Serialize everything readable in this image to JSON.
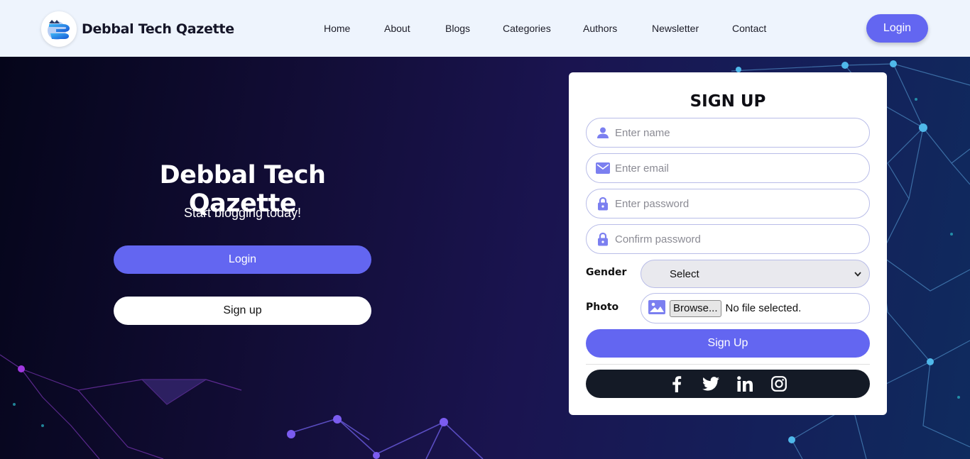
{
  "navbar": {
    "brand": "Debbal Tech Qazette",
    "links": [
      "Home",
      "About",
      "Blogs",
      "Categories",
      "Authors",
      "Newsletter",
      "Contact"
    ],
    "login_label": "Login"
  },
  "hero": {
    "title": "Debbal Tech Qazette",
    "subtitle": "Start blogging today!",
    "login_label": "Login",
    "signup_label": "Sign up"
  },
  "signup_form": {
    "title": "SIGN UP",
    "name_placeholder": "Enter name",
    "email_placeholder": "Enter email",
    "password_placeholder": "Enter password",
    "confirm_placeholder": "Confirm password",
    "gender_label": "Gender",
    "gender_value": "Select",
    "photo_label": "Photo",
    "browse_label": "Browse...",
    "file_status": "No file selected.",
    "submit_label": "Sign Up",
    "social_icons": [
      "facebook-icon",
      "twitter-icon",
      "linkedin-icon",
      "instagram-icon"
    ]
  },
  "colors": {
    "accent": "#6366f1",
    "navbar_bg": "#eef4fd",
    "social_bar": "#141a26",
    "icon_accent": "#7b7ff0"
  }
}
